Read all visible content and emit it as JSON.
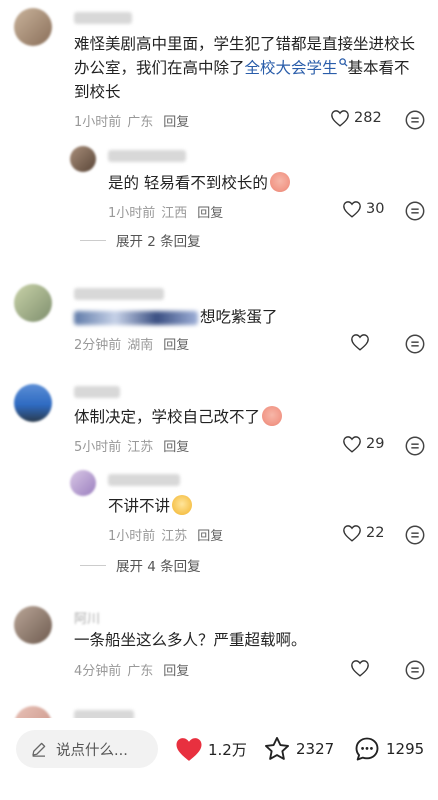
{
  "comments": [
    {
      "text_pre": "难怪美剧高中里面，学生犯了错都是直接坐进校长办公室，我们在高中除了",
      "link": "全校大会学生",
      "text_post": "基本看不到校长",
      "time": "1小时前",
      "location": "广东",
      "reply": "回复",
      "likes": "282",
      "replies": [
        {
          "text": "是的 轻易看不到校长的",
          "time": "1小时前",
          "location": "江西",
          "reply": "回复",
          "likes": "30"
        }
      ],
      "expand": "展开 2 条回复"
    },
    {
      "text": "想吃紫蛋了",
      "time": "2分钟前",
      "location": "湖南",
      "reply": "回复",
      "likes": ""
    },
    {
      "text": "体制决定，学校自己改不了",
      "time": "5小时前",
      "location": "江苏",
      "reply": "回复",
      "likes": "29",
      "replies": [
        {
          "text": "不讲不讲",
          "time": "1小时前",
          "location": "江苏",
          "reply": "回复",
          "likes": "22"
        }
      ],
      "expand": "展开 4 条回复"
    },
    {
      "name": "阿川",
      "text": "一条船坐这么多人？严重超载啊。",
      "time": "4分钟前",
      "location": "广东",
      "reply": "回复",
      "likes": ""
    }
  ],
  "bottom": {
    "placeholder": "说点什么...",
    "likes": "1.2万",
    "favorites": "2327",
    "comments": "1295"
  },
  "colors": {
    "like_heart": "#e8303f",
    "link": "#2a5daa"
  }
}
